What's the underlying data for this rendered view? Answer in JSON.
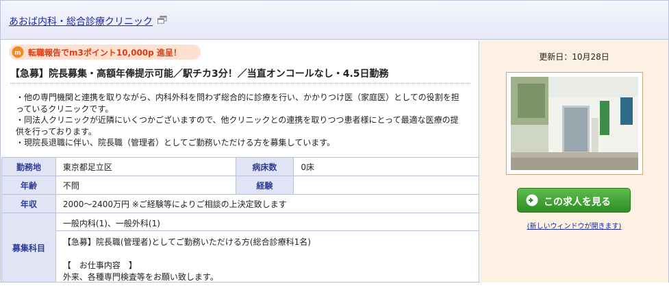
{
  "header": {
    "clinic_name": "あおば内科・総合診療クリニック",
    "external_icon": "external-window-icon"
  },
  "promo": {
    "icon": "m3-icon",
    "text": "転職報告でm3ポイント10,000p 進呈！"
  },
  "job": {
    "title": "【急募】院長募集・高額年俸提示可能／駅チカ3分！／当直オンコールなし・4.5日勤務",
    "description": [
      "・他の専門機関と連携を取りながら、内科外科を問わず総合的に診療を行い、かかりつけ医（家庭医）としての役割を担っているクリニックです。",
      "・同法人クリニックが近隣にいくつかございますので、他クリニックとの連携を取りつつ患者様にとって最適な医療の提供を行っております。",
      "・現院長退職に伴い、院長職（管理者）としてご勤務いただける方を募集しています。"
    ]
  },
  "info": {
    "location_label": "勤務地",
    "location": "東京都足立区",
    "beds_label": "病床数",
    "beds": "0床",
    "age_label": "年齢",
    "age": "不問",
    "experience_label": "経験",
    "experience": "",
    "salary_label": "年収",
    "salary": "2000～2400万円 ※ご経験等によりご相談の上決定致します",
    "specialty_label": "募集科目",
    "specialty": "一般内科(1)、一般外科(1)",
    "detail_line1": "【急募】院長職(管理者)としてご勤務いただける方(総合診療科1名)",
    "detail_line2": "【　お仕事内容　】",
    "detail_line3": "外来、各種専門検査等をお願い致します。"
  },
  "sidebar": {
    "updated": "更新日：10月28日",
    "photo_alt": "clinic-building-photo",
    "cta_label": "この求人を見る",
    "cta_icon": "arrow-right-circle-icon",
    "new_window_note": "(新しいウィンドウが開きます)"
  },
  "colors": {
    "link": "#1a2aa8",
    "label_bg": "#e1e4f4",
    "label_text": "#2f3d99",
    "promo_text": "#e03a12",
    "cta_green": "#3fa532",
    "sidebar_bg": "#fdf1e4"
  }
}
